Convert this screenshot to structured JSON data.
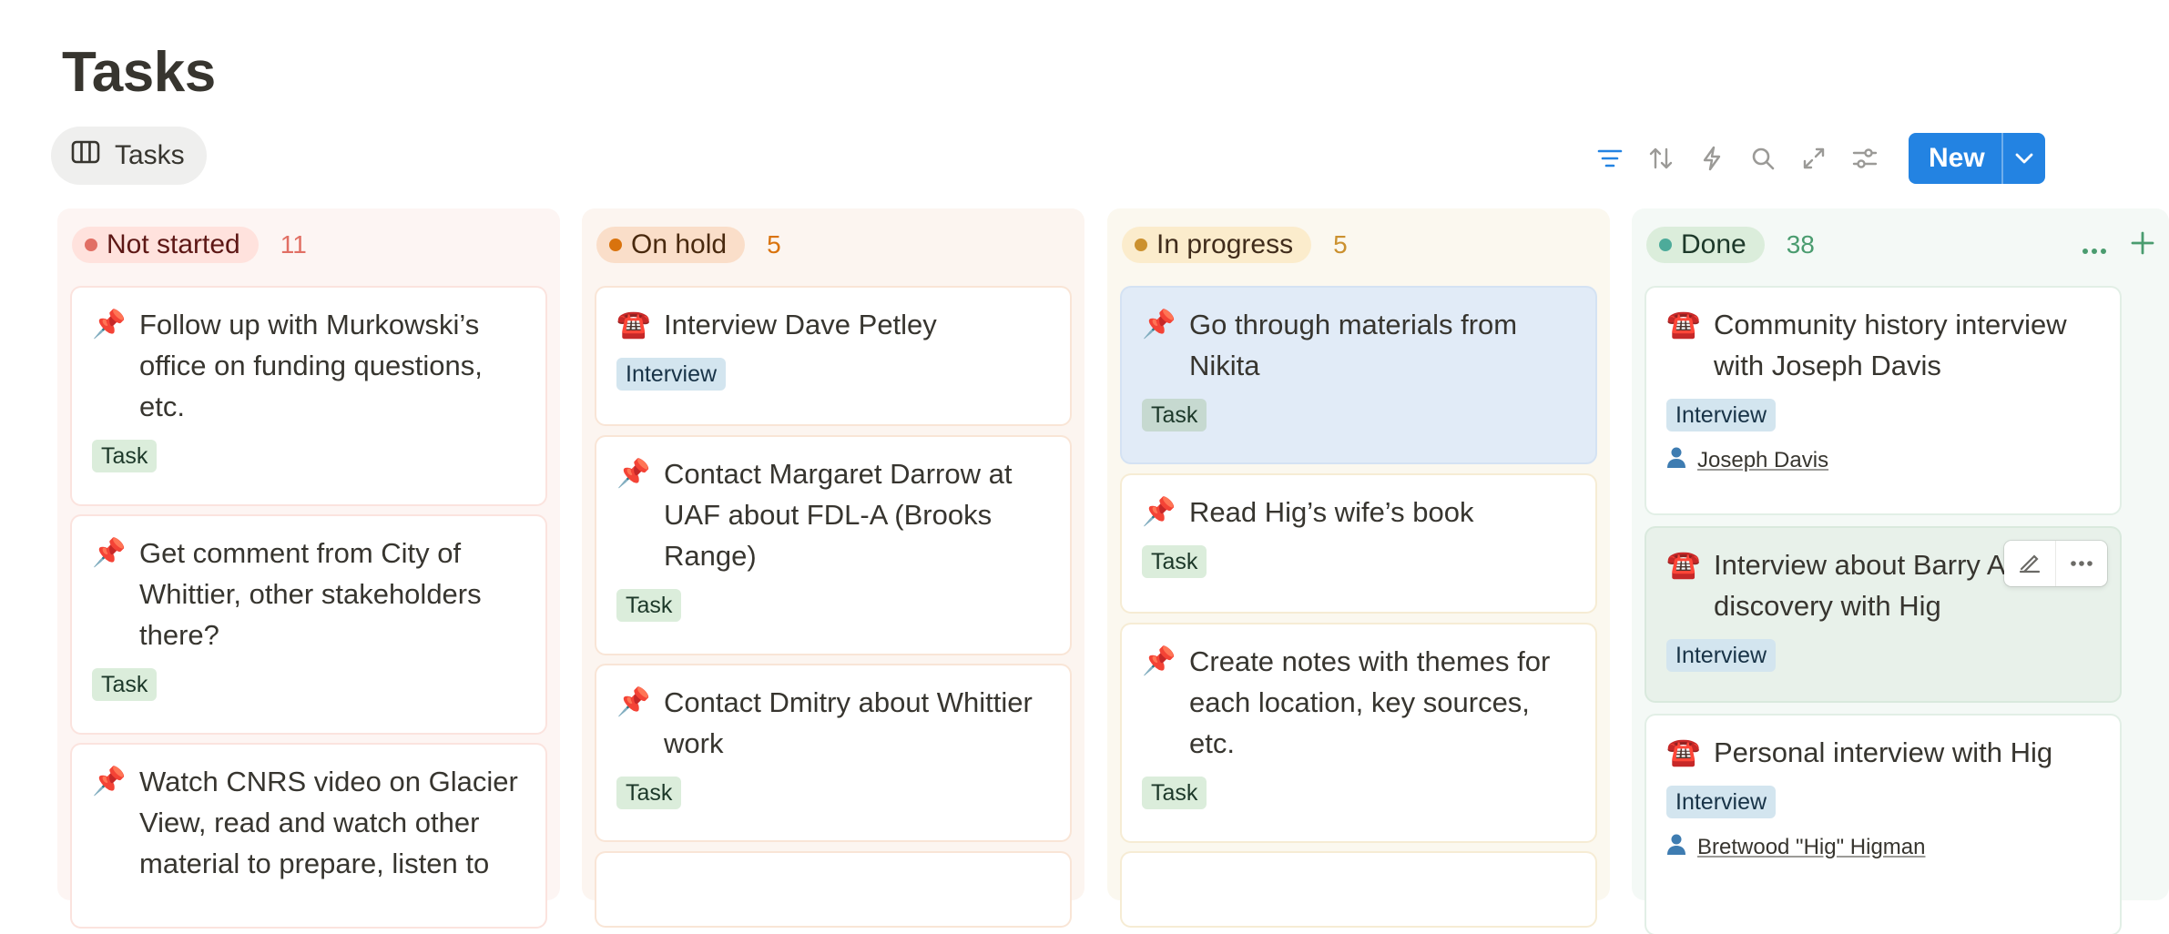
{
  "page": {
    "title": "Tasks"
  },
  "view_tab": {
    "label": "Tasks",
    "icon": "board-icon"
  },
  "toolbar": {
    "icons": [
      "filter-icon",
      "sort-icon",
      "lightning-icon",
      "search-icon",
      "expand-icon",
      "settings-icon"
    ],
    "new_label": "New",
    "accent": "#2383e2"
  },
  "columns": [
    {
      "name": "Not started",
      "count": "11",
      "colors": {
        "bg": "#fdf5f3",
        "pill": "#ffe2dd",
        "dot": "#e16f64",
        "count": "#e16f64"
      },
      "cards": [
        {
          "icon": "📌",
          "title": "Follow up with Murkowski’s office on funding questions, etc.",
          "tag": "Task"
        },
        {
          "icon": "📌",
          "title": "Get comment from City of Whittier, other stakeholders there?",
          "tag": "Task"
        },
        {
          "icon": "📌",
          "title": "Watch CNRS video on Glacier View, read and watch other material to prepare, listen to"
        }
      ]
    },
    {
      "name": "On hold",
      "count": "5",
      "colors": {
        "bg": "#fcf5f0",
        "pill": "#fadec9",
        "dot": "#d9730d",
        "count": "#d9730d"
      },
      "cards": [
        {
          "icon": "☎️",
          "title": "Interview Dave Petley",
          "tag": "Interview"
        },
        {
          "icon": "📌",
          "title": "Contact Margaret Darrow at UAF about FDL-A (Brooks Range)",
          "tag": "Task"
        },
        {
          "icon": "📌",
          "title": "Contact Dmitry about Whittier work",
          "tag": "Task"
        }
      ]
    },
    {
      "name": "In progress",
      "count": "5",
      "colors": {
        "bg": "#fbf8ef",
        "pill": "#fbeccc",
        "dot": "#cb912f",
        "count": "#cb912f"
      },
      "cards": [
        {
          "icon": "📌",
          "title": "Go through materials from Nikita",
          "tag": "Task"
        },
        {
          "icon": "📌",
          "title": "Read Hig’s wife’s book",
          "tag": "Task"
        },
        {
          "icon": "📌",
          "title": "Create notes with themes for each location, key sources, etc.",
          "tag": "Task"
        }
      ]
    },
    {
      "name": "Done",
      "count": "38",
      "colors": {
        "bg": "#f4f9f6",
        "pill": "#dbeddb",
        "dot": "#4dab9a",
        "count": "#4a9c6f"
      },
      "cards": [
        {
          "icon": "☎️",
          "title": "Community history interview with Joseph Davis",
          "tag": "Interview",
          "person": "Joseph Davis"
        },
        {
          "icon": "☎️",
          "title": "Interview about Barry Arm discovery with Hig",
          "tag": "Interview"
        },
        {
          "icon": "☎️",
          "title": "Personal interview with Hig",
          "tag": "Interview",
          "person": "Bretwood \"Hig\" Higman"
        }
      ]
    }
  ]
}
